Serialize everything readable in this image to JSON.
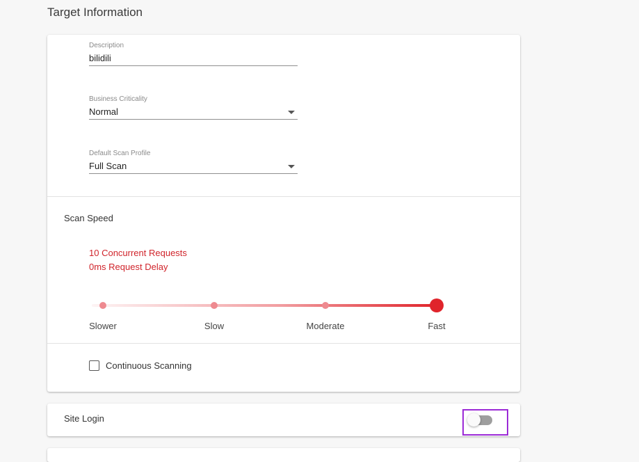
{
  "page": {
    "title": "Target Information"
  },
  "fields": {
    "description": {
      "label": "Description",
      "value": "bilidili"
    },
    "business_criticality": {
      "label": "Business Criticality",
      "value": "Normal"
    },
    "scan_profile": {
      "label": "Default Scan Profile",
      "value": "Full Scan"
    }
  },
  "scan_speed": {
    "title": "Scan Speed",
    "concurrent_requests": "10 Concurrent Requests",
    "request_delay": "0ms Request Delay",
    "levels": [
      "Slower",
      "Slow",
      "Moderate",
      "Fast"
    ],
    "selected_level": "Fast",
    "accent_color": "#e0242b"
  },
  "continuous_scanning": {
    "label": "Continuous Scanning",
    "checked": false
  },
  "site_login": {
    "title": "Site Login",
    "enabled": false,
    "highlight_color": "#9b2ad6"
  }
}
